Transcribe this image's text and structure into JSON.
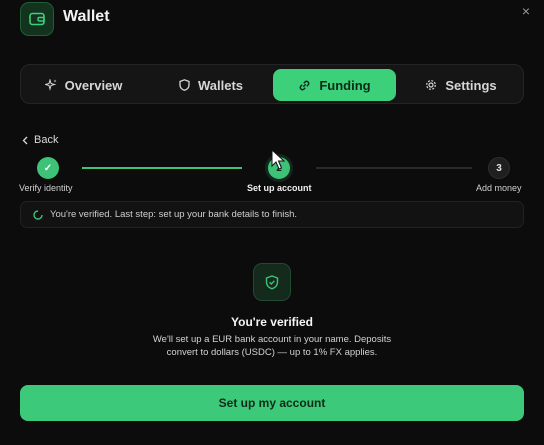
{
  "app": {
    "title": "Wallet",
    "close_glyph": "×",
    "icon": "wallet-icon"
  },
  "tabs": [
    {
      "label": "Overview",
      "icon": "sparkle-icon",
      "active": false
    },
    {
      "label": "Wallets",
      "icon": "shield-icon",
      "active": false
    },
    {
      "label": "Funding",
      "icon": "link-icon",
      "active": true
    },
    {
      "label": "Settings",
      "icon": "gear-icon",
      "active": false
    }
  ],
  "back": {
    "label": "Back",
    "icon": "chevron-left-icon"
  },
  "stepper": {
    "steps": [
      {
        "label": "Verify identity",
        "marker": "✓",
        "state": "done"
      },
      {
        "label": "Set up account",
        "marker": "2",
        "state": "current"
      },
      {
        "label": "Add money",
        "marker": "3",
        "state": "todo"
      }
    ]
  },
  "status": {
    "text": "You're verified. Last step: set up your bank details to finish.",
    "icon": "spinner-icon"
  },
  "content": {
    "icon": "shield-check-icon",
    "title": "You're verified",
    "description": "We'll set up a EUR bank account in your name. Deposits convert to dollars (USDC) — up to 1% FX applies."
  },
  "primary_button": {
    "label": "Set up my account"
  },
  "colors": {
    "accent": "#3dc97a",
    "background": "#0c0c0c",
    "panel": "#151515"
  }
}
